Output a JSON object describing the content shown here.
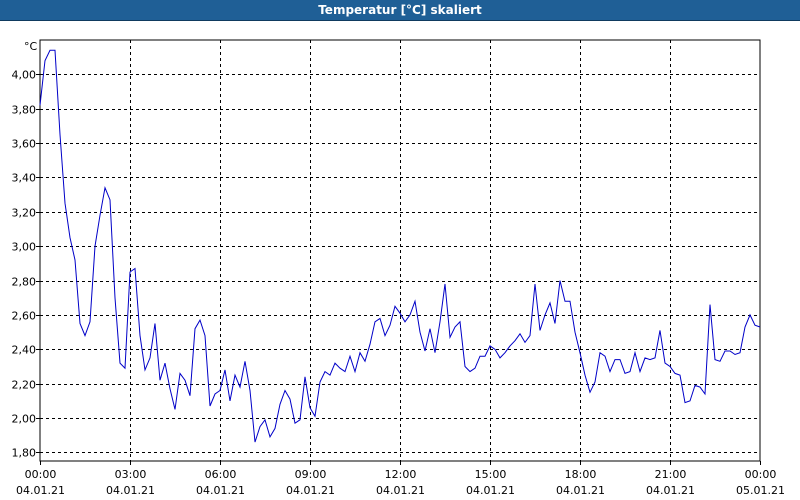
{
  "window": {
    "title": "Temperatur [°C] skaliert"
  },
  "chart_data": {
    "type": "line",
    "title": "Temperatur [°C] skaliert",
    "ylabel": "°C",
    "xlabel": "",
    "ylim": [
      1.75,
      4.2
    ],
    "y_ticks": [
      1.8,
      2.0,
      2.2,
      2.4,
      2.6,
      2.8,
      3.0,
      3.2,
      3.4,
      3.6,
      3.8,
      4.0
    ],
    "y_tick_labels": [
      "1,80",
      "2,00",
      "2,20",
      "2,40",
      "2,60",
      "2,80",
      "3,00",
      "3,20",
      "3,40",
      "3,60",
      "3,80",
      "4,00"
    ],
    "xlim": [
      "04.01.21 00:00",
      "05.01.21 00:00"
    ],
    "x_ticks": [
      {
        "time": "00:00",
        "date": "04.01.21"
      },
      {
        "time": "03:00",
        "date": "04.01.21"
      },
      {
        "time": "06:00",
        "date": "04.01.21"
      },
      {
        "time": "09:00",
        "date": "04.01.21"
      },
      {
        "time": "12:00",
        "date": "04.01.21"
      },
      {
        "time": "15:00",
        "date": "04.01.21"
      },
      {
        "time": "18:00",
        "date": "04.01.21"
      },
      {
        "time": "21:00",
        "date": "04.01.21"
      },
      {
        "time": "00:00",
        "date": "05.01.21"
      }
    ],
    "grid": true,
    "line_color": "#0000c8",
    "series": [
      {
        "x": [
          "00:00",
          "00:10",
          "00:20",
          "00:30",
          "00:40",
          "00:50",
          "01:00",
          "01:10",
          "01:20",
          "01:30",
          "01:40",
          "01:50",
          "02:00",
          "02:10",
          "02:20",
          "02:30",
          "02:40",
          "02:50",
          "03:00",
          "03:10",
          "03:20",
          "03:30",
          "03:40",
          "03:50",
          "04:00",
          "04:10",
          "04:20",
          "04:30",
          "04:40",
          "04:50",
          "05:00",
          "05:10",
          "05:20",
          "05:30",
          "05:40",
          "05:50",
          "06:00",
          "06:10",
          "06:20",
          "06:30",
          "06:40",
          "06:50",
          "07:00",
          "07:10",
          "07:20",
          "07:30",
          "07:40",
          "07:50",
          "08:00",
          "08:10",
          "08:20",
          "08:30",
          "08:40",
          "08:50",
          "09:00",
          "09:10",
          "09:20",
          "09:30",
          "09:40",
          "09:50",
          "10:00",
          "10:10",
          "10:20",
          "10:30",
          "10:40",
          "10:50",
          "11:00",
          "11:10",
          "11:20",
          "11:30",
          "11:40",
          "11:50",
          "12:00",
          "12:10",
          "12:20",
          "12:30",
          "12:40",
          "12:50",
          "13:00",
          "13:10",
          "13:20",
          "13:30",
          "13:40",
          "13:50",
          "14:00",
          "14:10",
          "14:20",
          "14:30",
          "14:40",
          "14:50",
          "15:00",
          "15:10",
          "15:20",
          "15:30",
          "15:40",
          "15:50",
          "16:00",
          "16:10",
          "16:20",
          "16:30",
          "16:40",
          "16:50",
          "17:00",
          "17:10",
          "17:20",
          "17:30",
          "17:40",
          "17:50",
          "18:00",
          "18:10",
          "18:20",
          "18:30",
          "18:40",
          "18:50",
          "19:00",
          "19:10",
          "19:20",
          "19:30",
          "19:40",
          "19:50",
          "20:00",
          "20:10",
          "20:20",
          "20:30",
          "20:40",
          "20:50",
          "21:00",
          "21:10",
          "21:20",
          "21:30",
          "21:40",
          "21:50",
          "22:00",
          "22:10",
          "22:20",
          "22:30",
          "22:40",
          "22:50",
          "23:00",
          "23:10",
          "23:20",
          "23:30",
          "23:40",
          "23:50",
          "24:00"
        ],
        "values": [
          3.82,
          4.08,
          4.14,
          4.14,
          3.65,
          3.25,
          3.05,
          2.92,
          2.55,
          2.48,
          2.56,
          3.0,
          3.18,
          3.34,
          3.27,
          2.7,
          2.32,
          2.29,
          2.85,
          2.87,
          2.48,
          2.28,
          2.35,
          2.55,
          2.22,
          2.32,
          2.17,
          2.05,
          2.26,
          2.22,
          2.13,
          2.52,
          2.57,
          2.48,
          2.07,
          2.14,
          2.16,
          2.28,
          2.1,
          2.25,
          2.18,
          2.33,
          2.16,
          1.86,
          1.95,
          1.99,
          1.89,
          1.94,
          2.08,
          2.16,
          2.11,
          1.97,
          1.99,
          2.24,
          2.06,
          2.01,
          2.21,
          2.27,
          2.25,
          2.32,
          2.29,
          2.27,
          2.36,
          2.27,
          2.38,
          2.33,
          2.43,
          2.56,
          2.58,
          2.48,
          2.54,
          2.65,
          2.61,
          2.56,
          2.6,
          2.68,
          2.5,
          2.39,
          2.52,
          2.38,
          2.56,
          2.78,
          2.47,
          2.53,
          2.56,
          2.3,
          2.27,
          2.29,
          2.36,
          2.36,
          2.42,
          2.4,
          2.35,
          2.38,
          2.42,
          2.45,
          2.49,
          2.44,
          2.48,
          2.78,
          2.51,
          2.6,
          2.67,
          2.55,
          2.8,
          2.68,
          2.68,
          2.5,
          2.38,
          2.25,
          2.15,
          2.21,
          2.38,
          2.36,
          2.27,
          2.34,
          2.34,
          2.26,
          2.27,
          2.38,
          2.27,
          2.35,
          2.34,
          2.35,
          2.51,
          2.32,
          2.3,
          2.26,
          2.25,
          2.09,
          2.1,
          2.19,
          2.18,
          2.14,
          2.66,
          2.34,
          2.33,
          2.39,
          2.39,
          2.37,
          2.38,
          2.53,
          2.6,
          2.54,
          2.53
        ]
      }
    ]
  }
}
